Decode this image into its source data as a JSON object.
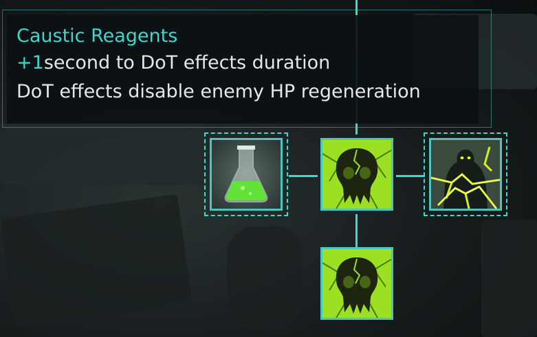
{
  "tooltip": {
    "title": "Caustic Reagents",
    "line1_number": "+1",
    "line1_text": "second to DoT effects duration",
    "line2_text": "DoT effects disable enemy HP regeneration"
  },
  "skill_tree": {
    "nodes": [
      {
        "name": "Caustic Reagents",
        "icon": "flask-icon",
        "state": "selected"
      },
      {
        "name": "",
        "icon": "toxic-skull-icon",
        "state": "unlocked"
      },
      {
        "name": "",
        "icon": "lightning-figure-icon",
        "state": "selected"
      },
      {
        "name": "",
        "icon": "toxic-skull-icon",
        "state": "unlocked"
      }
    ]
  },
  "colors": {
    "accent": "#3fd9d0",
    "toxic_green": "#9be022",
    "tooltip_bg": "#0c1012"
  }
}
